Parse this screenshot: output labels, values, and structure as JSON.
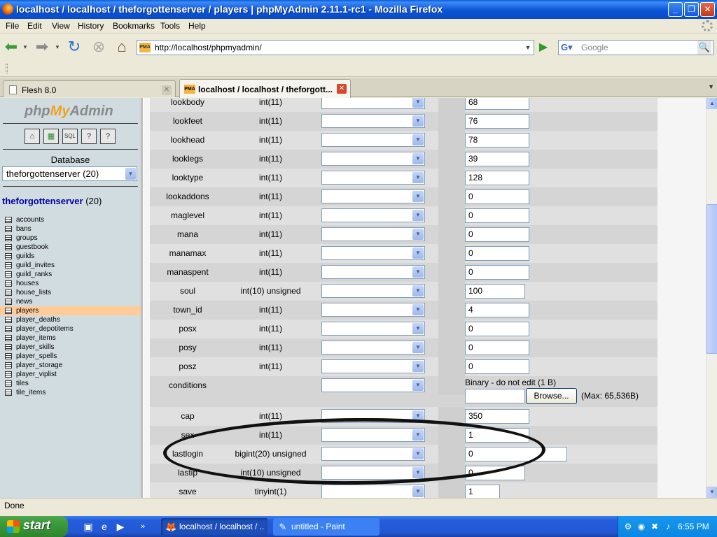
{
  "window": {
    "title": "localhost / localhost / theforgottenserver / players | phpMyAdmin 2.11.1-rc1 - Mozilla Firefox"
  },
  "menu": [
    "File",
    "Edit",
    "View",
    "History",
    "Bookmarks",
    "Tools",
    "Help"
  ],
  "nav": {
    "url": "http://localhost/phpmyadmin/",
    "search_placeholder": "Google"
  },
  "tabs": [
    {
      "label": "Flesh 8.0",
      "active": false
    },
    {
      "label": "localhost / localhost / theforgott...",
      "active": true
    }
  ],
  "sidebar": {
    "logo_php": "php",
    "logo_my": "My",
    "logo_admin": "Admin",
    "icons": [
      "home-icon",
      "query-window-icon",
      "sql-icon",
      "docs-icon",
      "help-icon"
    ],
    "database_label": "Database",
    "database_selected": "theforgottenserver (20)",
    "db_name": "theforgottenserver",
    "db_count": "(20)",
    "tables": [
      "accounts",
      "bans",
      "groups",
      "guestbook",
      "guilds",
      "guild_invites",
      "guild_ranks",
      "houses",
      "house_lists",
      "news",
      "players",
      "player_deaths",
      "player_depotitems",
      "player_items",
      "player_skills",
      "player_spells",
      "player_storage",
      "player_viplist",
      "tiles",
      "tile_items"
    ],
    "selected_table": "players"
  },
  "fields": [
    {
      "name": "lookbody",
      "type": "int(11)",
      "value": "68"
    },
    {
      "name": "lookfeet",
      "type": "int(11)",
      "value": "76"
    },
    {
      "name": "lookhead",
      "type": "int(11)",
      "value": "78"
    },
    {
      "name": "looklegs",
      "type": "int(11)",
      "value": "39"
    },
    {
      "name": "looktype",
      "type": "int(11)",
      "value": "128"
    },
    {
      "name": "lookaddons",
      "type": "int(11)",
      "value": "0"
    },
    {
      "name": "maglevel",
      "type": "int(11)",
      "value": "0"
    },
    {
      "name": "mana",
      "type": "int(11)",
      "value": "0"
    },
    {
      "name": "manamax",
      "type": "int(11)",
      "value": "0"
    },
    {
      "name": "manaspent",
      "type": "int(11)",
      "value": "0"
    },
    {
      "name": "soul",
      "type": "int(10) unsigned",
      "value": "100"
    },
    {
      "name": "town_id",
      "type": "int(11)",
      "value": "4"
    },
    {
      "name": "posx",
      "type": "int(11)",
      "value": "0"
    },
    {
      "name": "posy",
      "type": "int(11)",
      "value": "0"
    },
    {
      "name": "posz",
      "type": "int(11)",
      "value": "0"
    },
    {
      "name": "conditions",
      "type": "",
      "binary_label": "Binary - do not edit (1 B)",
      "browse_label": "Browse...",
      "max_label": "(Max: 65,536B)"
    },
    {
      "name": "cap",
      "type": "int(11)",
      "value": "350"
    },
    {
      "name": "sex",
      "type": "int(11)",
      "value": "1"
    },
    {
      "name": "lastlogin",
      "type": "bigint(20) unsigned",
      "value": "0"
    },
    {
      "name": "lastip",
      "type": "int(10) unsigned",
      "value": "0"
    },
    {
      "name": "save",
      "type": "tinyint(1)",
      "value": "1"
    }
  ],
  "status": "Done",
  "taskbar": {
    "start_label": "start",
    "buttons": [
      {
        "label": "localhost / localhost / ...",
        "active": true
      },
      {
        "label": "untitled - Paint",
        "active": false
      }
    ],
    "clock": "6:55 PM"
  }
}
